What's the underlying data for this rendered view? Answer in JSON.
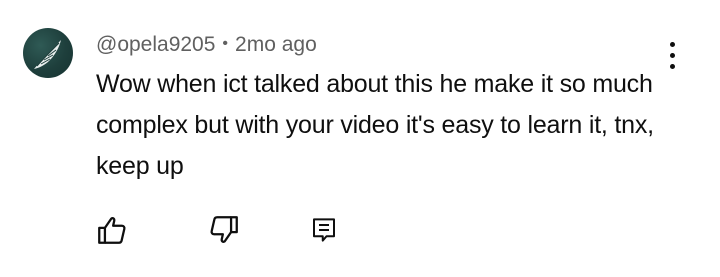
{
  "comment": {
    "author": "@opela9205",
    "separator": "•",
    "time": "2mo ago",
    "text": "Wow when ict talked about this he make it so much complex but with your video it's easy to learn it, tnx, keep up",
    "avatar_icon": "feather-wing-icon"
  },
  "actions": {
    "like_icon": "thumbs-up-icon",
    "dislike_icon": "thumbs-down-icon",
    "reply_icon": "reply-comment-icon",
    "more_icon": "more-vertical-icon"
  },
  "colors": {
    "text": "#0f0f0f",
    "meta": "#606060",
    "avatar_bg": "#1e3f3c"
  }
}
